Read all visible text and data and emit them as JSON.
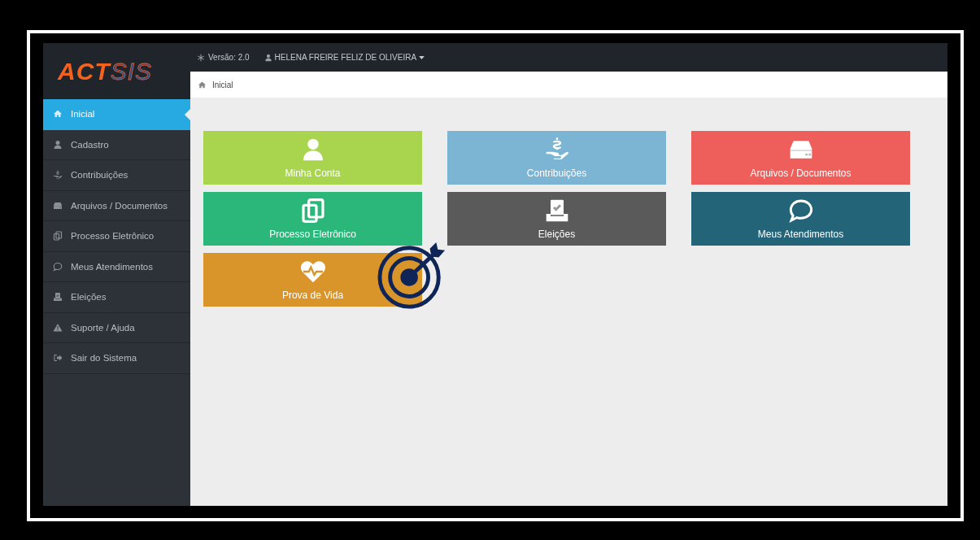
{
  "logo": {
    "part_1": "ACT",
    "part_2": "SIS"
  },
  "header": {
    "version": "Versão: 2.0",
    "user": "HELENA FREIRE FELIZ DE OLIVEIRA"
  },
  "breadcrumb": "Inicial",
  "sidebar": {
    "items": [
      {
        "label": "Inicial",
        "selected": true
      },
      {
        "label": "Cadastro",
        "selected": false
      },
      {
        "label": "Contribuições",
        "selected": false
      },
      {
        "label": "Arquivos / Documentos",
        "selected": false
      },
      {
        "label": "Processo Eletrônico",
        "selected": false
      },
      {
        "label": "Meus Atendimentos",
        "selected": false
      },
      {
        "label": "Eleições",
        "selected": false
      },
      {
        "label": "Suporte / Ajuda",
        "selected": false
      },
      {
        "label": "Sair do Sistema",
        "selected": false
      }
    ]
  },
  "tiles": [
    {
      "label": "Minha Conta",
      "color": "#a8d44e"
    },
    {
      "label": "Contribuições",
      "color": "#7cb4d4"
    },
    {
      "label": "Arquivos / Documentos",
      "color": "#ee5f5b"
    },
    {
      "label": "Processo Eletrônico",
      "color": "#2bb779"
    },
    {
      "label": "Eleições",
      "color": "#5a5a5a"
    },
    {
      "label": "Meus Atendimentos",
      "color": "#236478"
    },
    {
      "label": "Prova de Vida",
      "color": "#d9952a"
    }
  ]
}
